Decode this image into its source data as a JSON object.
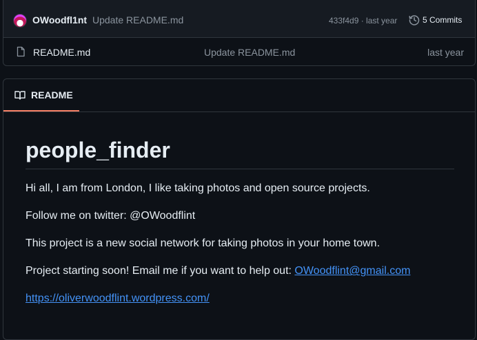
{
  "commit_bar": {
    "author": "OWoodfl1nt",
    "message": "Update README.md",
    "meta": "433f4d9 · last year",
    "commits_label": "5 Commits"
  },
  "files": [
    {
      "name": "README.md",
      "commit_message": "Update README.md",
      "time": "last year",
      "icon": "file-icon"
    }
  ],
  "readme": {
    "tab_label": "README",
    "title": "people_finder",
    "paragraph_1": "Hi all, I am from London, I like taking photos and open source projects.",
    "paragraph_2": "Follow me on twitter: @OWoodflint",
    "paragraph_3": "This project is a new social network for taking photos in your home town.",
    "paragraph_4_prefix": "Project starting soon! Email me if you want to help out: ",
    "email_link": "OWoodflint@gmail.com",
    "website_link": "https://oliverwoodflint.wordpress.com/"
  },
  "colors": {
    "background": "#0d1117",
    "link": "#4493f8",
    "tab_underline": "#f78166",
    "muted": "#8b949e"
  }
}
